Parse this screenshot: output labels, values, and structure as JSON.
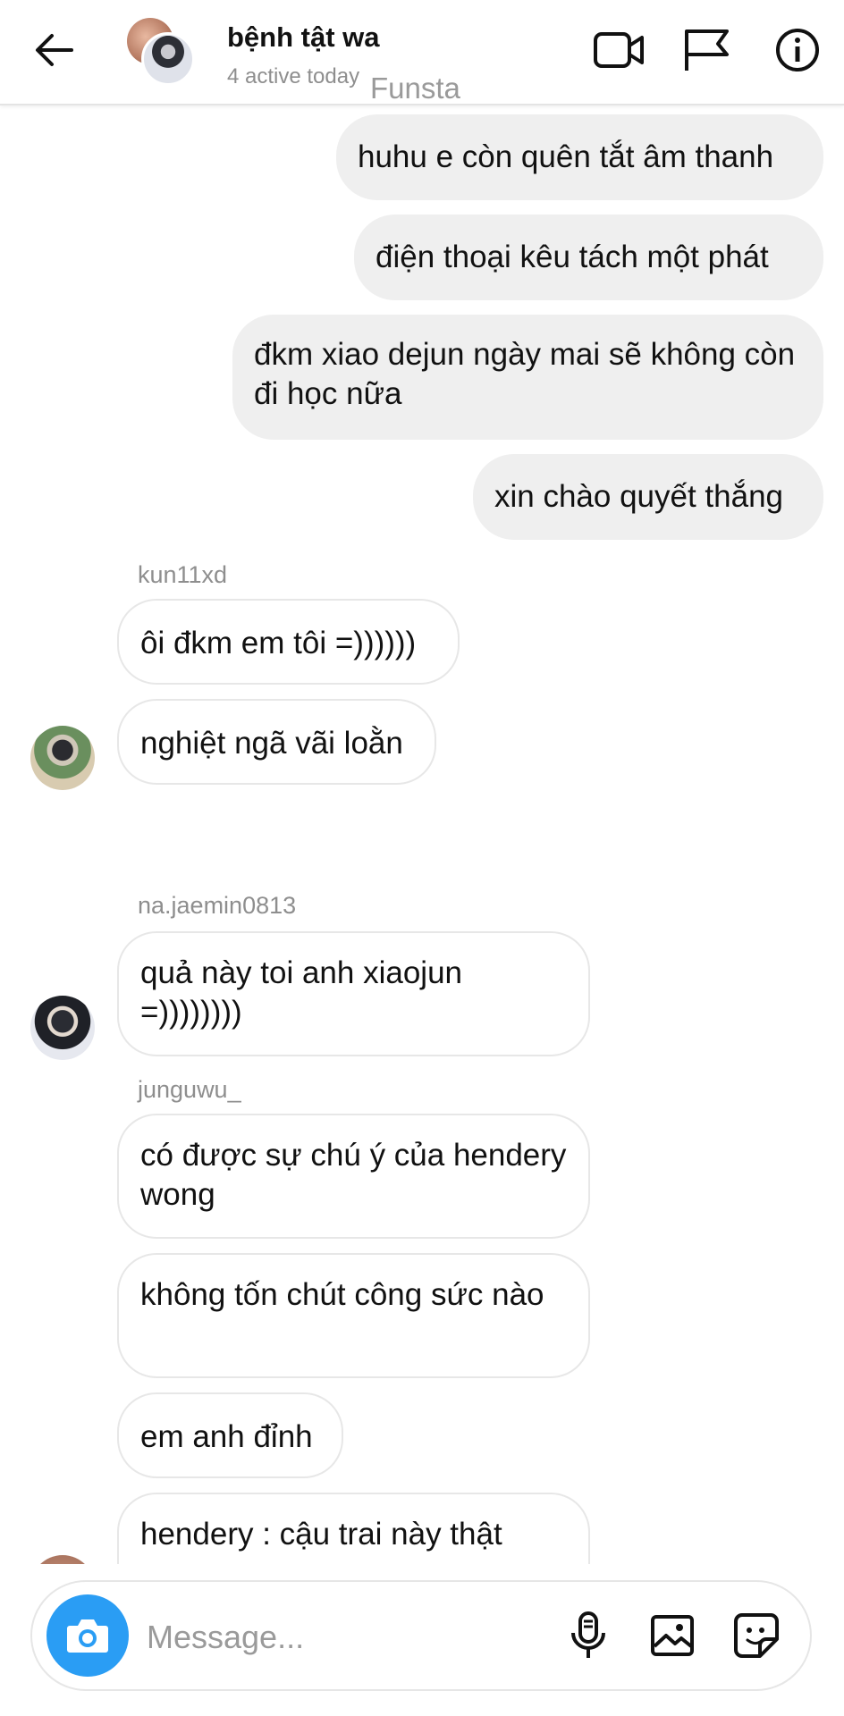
{
  "header": {
    "title": "bệnh tật wa",
    "subtitle": "4 active today",
    "watermark": "Funsta"
  },
  "icons": {
    "back": "arrow-left-icon",
    "video": "video-camera-icon",
    "flag": "flag-icon",
    "info": "info-icon",
    "camera": "camera-icon",
    "mic": "microphone-icon",
    "gallery": "image-icon",
    "sticker": "sticker-icon"
  },
  "messages": {
    "out1": "huhu e còn quên tắt âm thanh",
    "out2": "điện thoại kêu tách một phát",
    "out3": "đkm xiao dejun ngày mai sẽ không còn đi học nữa",
    "out4": "xin chào quyết thắng",
    "sender_kun": "kun11xd",
    "kun1": "ôi đkm em tôi =))))))",
    "kun2": "nghiệt ngã vãi loằn",
    "sender_na": "na.jaemin0813",
    "na1": "quả này toi anh xiaojun =))))))))",
    "sender_jung": "junguwu_",
    "jung1": "có được sự chú ý của hendery wong",
    "jung2": "không tốn chút công sức nào",
    "jung3": "em anh đỉnh",
    "jung4": "hendery : cậu trai này thật"
  },
  "composer": {
    "placeholder": "Message..."
  },
  "colors": {
    "accent": "#2a9df4",
    "outgoing_bubble": "#efefef",
    "incoming_border": "#e7e7e7",
    "secondary_text": "#8e8e8e"
  }
}
